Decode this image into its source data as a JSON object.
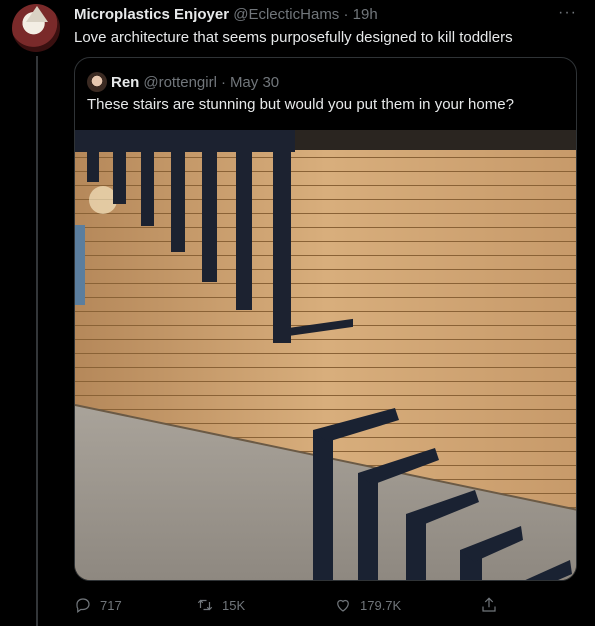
{
  "tweet": {
    "author_name": "Microplastics Enjoyer",
    "handle": "@EclecticHams",
    "separator": "·",
    "time": "19h",
    "more": "···",
    "text": "Love architecture that seems purposefully designed to kill toddlers"
  },
  "quoted": {
    "author_name": "Ren",
    "handle": "@rottengirl",
    "separator": "·",
    "date": "May 30",
    "text": "These stairs are stunning but would you put them in your home?"
  },
  "actions": {
    "replies": "717",
    "retweets": "15K",
    "likes": "179.7K"
  },
  "colors": {
    "background": "#000000",
    "text": "#e7e9ea",
    "muted": "#71767b",
    "border": "#2f3336"
  },
  "icons": [
    "reply-icon",
    "retweet-icon",
    "like-icon",
    "share-icon",
    "more-icon"
  ]
}
